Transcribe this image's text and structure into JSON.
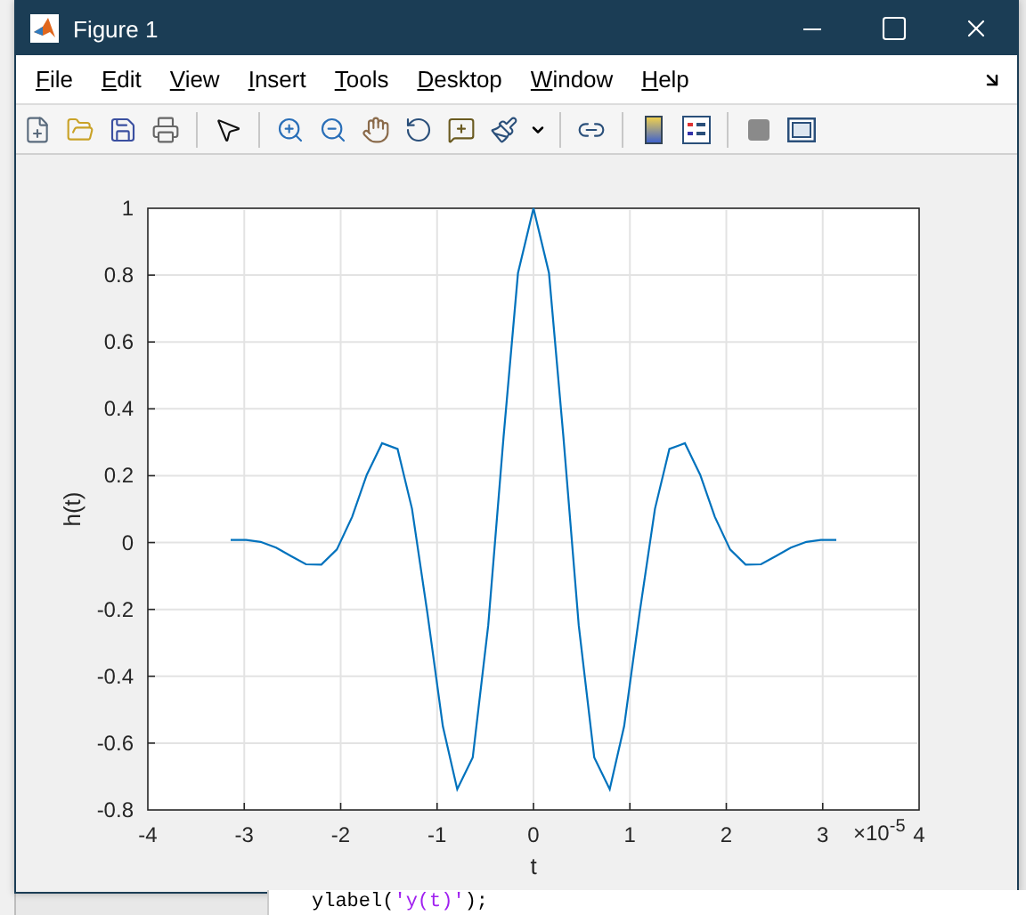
{
  "window": {
    "title": "Figure 1"
  },
  "menu": [
    {
      "label": "File"
    },
    {
      "label": "Edit"
    },
    {
      "label": "View"
    },
    {
      "label": "Insert"
    },
    {
      "label": "Tools"
    },
    {
      "label": "Desktop"
    },
    {
      "label": "Window"
    },
    {
      "label": "Help"
    }
  ],
  "chart_data": {
    "type": "line",
    "xlabel": "t",
    "ylabel": "h(t)",
    "xlim": [
      -4,
      4
    ],
    "ylim": [
      -0.8,
      1
    ],
    "xticks": [
      -4,
      -3,
      -2,
      -1,
      0,
      1,
      2,
      3,
      4
    ],
    "yticks": [
      -0.8,
      -0.6,
      -0.4,
      -0.2,
      0,
      0.2,
      0.4,
      0.6,
      0.8,
      1
    ],
    "x": [
      -3.14,
      -2.98,
      -2.83,
      -2.67,
      -2.51,
      -2.36,
      -2.2,
      -2.04,
      -1.88,
      -1.73,
      -1.57,
      -1.41,
      -1.26,
      -1.1,
      -0.94,
      -0.79,
      -0.63,
      -0.47,
      -0.31,
      -0.16,
      0,
      0.16,
      0.31,
      0.47,
      0.63,
      0.79,
      0.94,
      1.1,
      1.26,
      1.41,
      1.57,
      1.73,
      1.88,
      2.04,
      2.2,
      2.36,
      2.51,
      2.67,
      2.83,
      2.98,
      3.14
    ],
    "series": [
      {
        "color": "#0072bd",
        "values": [
          0.008,
          0.008,
          0.002,
          -0.015,
          -0.041,
          -0.065,
          -0.066,
          -0.021,
          0.077,
          0.203,
          0.297,
          0.28,
          0.101,
          -0.213,
          -0.549,
          -0.738,
          -0.643,
          -0.247,
          0.316,
          0.806,
          1,
          0.806,
          0.316,
          -0.247,
          -0.643,
          -0.738,
          -0.549,
          -0.213,
          0.101,
          0.28,
          0.297,
          0.203,
          0.077,
          -0.021,
          -0.066,
          -0.065,
          -0.041,
          -0.015,
          0.002,
          0.008,
          0.008
        ]
      }
    ],
    "grid": true,
    "annotations": [
      {
        "text": "×10$^{-5}$"
      }
    ]
  },
  "background": {
    "code_line": [
      {
        "kind": "plain",
        "text": "ylabel("
      },
      {
        "kind": "string",
        "text": "'y(t)'"
      },
      {
        "kind": "plain",
        "text": ");"
      }
    ]
  }
}
